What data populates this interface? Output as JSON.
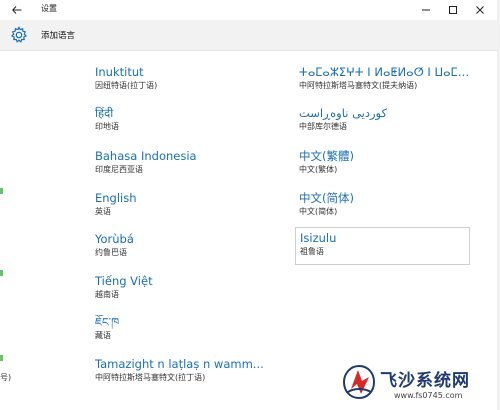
{
  "titlebar": {
    "title": "设置",
    "back_icon": "back-arrow-icon",
    "minimize_icon": "minimize-icon",
    "maximize_icon": "maximize-icon",
    "close_icon": "close-icon"
  },
  "header": {
    "icon": "gear-icon",
    "title": "添加语言"
  },
  "languages_left": [
    {
      "name": "Inuktitut",
      "sub": "因纽特语(拉丁语)"
    },
    {
      "name": "हिंदी",
      "sub": "印地语"
    },
    {
      "name": "Bahasa Indonesia",
      "sub": "印度尼西亚语"
    },
    {
      "name": "English",
      "sub": "英语"
    },
    {
      "name": "Yorùbá",
      "sub": "约鲁巴语"
    },
    {
      "name": "Tiếng Việt",
      "sub": "越南语"
    },
    {
      "name": "ཇོང་ཁ",
      "sub": "藏语"
    },
    {
      "name": "Tamazight n laṭlaṣ n wamm...",
      "sub": "中阿特拉斯塔马塞特文(拉丁语)"
    }
  ],
  "languages_right": [
    {
      "name": "ⵜⴰⵎⴰⵣⵉⵖⵜ ⵏ ⵍⴰⵟⵍⴰⵚ ⵏ ⵡⴰⵎⵎⴰⵙ",
      "sub": "中阿特拉斯塔马塞特文(提夫纳语)"
    },
    {
      "name": "کوردیی ناوەڕاست",
      "sub": "中部库尔德语"
    },
    {
      "name": "中文(繁體)",
      "sub": "中文(繁体)"
    },
    {
      "name": "中文(简体)",
      "sub": "中文(简体)"
    },
    {
      "name": "Isizulu",
      "sub": "祖鲁语",
      "selected": true
    }
  ],
  "left_edge_text": "号)",
  "watermark": {
    "title": "飞沙系统网",
    "url": "www.fs0745.com"
  }
}
